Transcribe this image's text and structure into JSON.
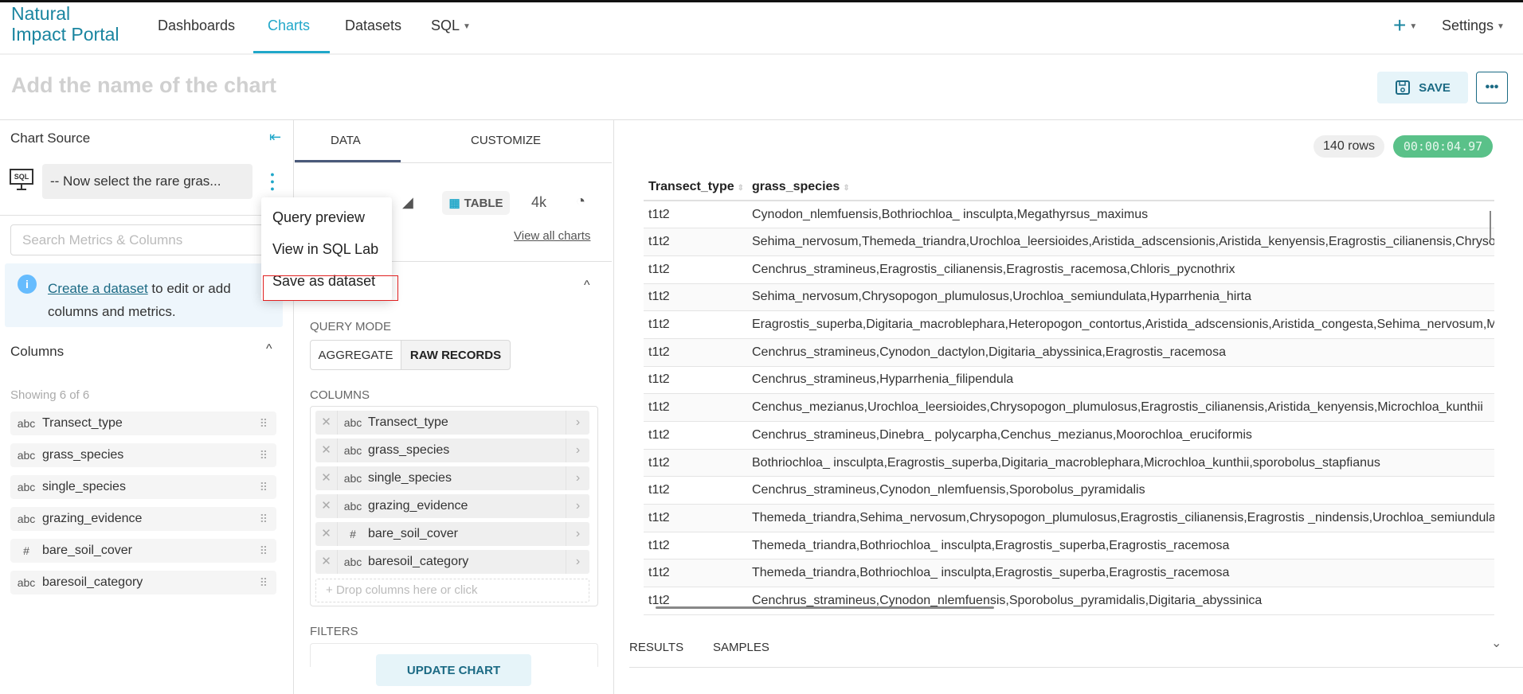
{
  "nav": {
    "logo_line1": "Natural",
    "logo_line2": "Impact Portal",
    "items": [
      {
        "label": "Dashboards"
      },
      {
        "label": "Charts"
      },
      {
        "label": "Datasets"
      },
      {
        "label": "SQL"
      }
    ],
    "plus": "+",
    "settings": "Settings"
  },
  "header": {
    "title_placeholder": "Add the name of the chart",
    "save": "SAVE",
    "more": "•••"
  },
  "source": {
    "heading": "Chart Source",
    "sql_icon": "SQL",
    "query_name": "-- Now select the rare gras...",
    "search_placeholder": "Search Metrics & Columns",
    "info_link": "Create a dataset",
    "info_rest": " to edit or add columns and metrics."
  },
  "menu": {
    "items": [
      "Query preview",
      "View in SQL Lab",
      "Save as dataset"
    ]
  },
  "columns_panel": {
    "heading": "Columns",
    "showing": "Showing 6 of 6",
    "items": [
      {
        "type": "abc",
        "name": "Transect_type"
      },
      {
        "type": "abc",
        "name": "grass_species"
      },
      {
        "type": "abc",
        "name": "single_species"
      },
      {
        "type": "abc",
        "name": "grazing_evidence"
      },
      {
        "type": "#",
        "name": "bare_soil_cover"
      },
      {
        "type": "abc",
        "name": "baresoil_category"
      }
    ]
  },
  "control": {
    "tabs": [
      "DATA",
      "CUSTOMIZE"
    ],
    "viz_table": "TABLE",
    "viz_4k": "4k",
    "view_all": "View all charts",
    "query_mode": "QUERY MODE",
    "modes": [
      "AGGREGATE",
      "RAW RECORDS"
    ],
    "columns_label": "COLUMNS",
    "drop_hint": "Drop columns here or click",
    "filters_label": "FILTERS",
    "update": "UPDATE CHART"
  },
  "results": {
    "rows_badge": "140 rows",
    "timer": "00:00:04.97",
    "timer_color": "#5ac189",
    "headers": [
      "Transect_type",
      "grass_species"
    ],
    "rows": [
      [
        "t1t2",
        "Cynodon_nlemfuensis,Bothriochloa_ insculpta,Megathyrsus_maximus"
      ],
      [
        "t1t2",
        "Sehima_nervosum,Themeda_triandra,Urochloa_leersioides,Aristida_adscensionis,Aristida_kenyensis,Eragrostis_cilianensis,Chrysopo"
      ],
      [
        "t1t2",
        "Cenchrus_stramineus,Eragrostis_cilianensis,Eragrostis_racemosa,Chloris_pycnothrix"
      ],
      [
        "t1t2",
        "Sehima_nervosum,Chrysopogon_plumulosus,Urochloa_semiundulata,Hyparrhenia_hirta"
      ],
      [
        "t1t2",
        "Eragrostis_superba,Digitaria_macroblephara,Heteropogon_contortus,Aristida_adscensionis,Aristida_congesta,Sehima_nervosum,Me"
      ],
      [
        "t1t2",
        "Cenchrus_stramineus,Cynodon_dactylon,Digitaria_abyssinica,Eragrostis_racemosa"
      ],
      [
        "t1t2",
        "Cenchrus_stramineus,Hyparrhenia_filipendula"
      ],
      [
        "t1t2",
        "Cenchus_mezianus,Urochloa_leersioides,Chrysopogon_plumulosus,Eragrostis_cilianensis,Aristida_kenyensis,Microchloa_kunthii"
      ],
      [
        "t1t2",
        "Cenchrus_stramineus,Dinebra_ polycarpha,Cenchus_mezianus,Moorochloa_eruciformis"
      ],
      [
        "t1t2",
        "Bothriochloa_ insculpta,Eragrostis_superba,Digitaria_macroblephara,Microchloa_kunthii,sporobolus_stapfianus"
      ],
      [
        "t1t2",
        "Cenchrus_stramineus,Cynodon_nlemfuensis,Sporobolus_pyramidalis"
      ],
      [
        "t1t2",
        "Themeda_triandra,Sehima_nervosum,Chrysopogon_plumulosus,Eragrostis_cilianensis,Eragrostis _nindensis,Urochloa_semiundulata"
      ],
      [
        "t1t2",
        "Themeda_triandra,Bothriochloa_ insculpta,Eragrostis_superba,Eragrostis_racemosa"
      ],
      [
        "t1t2",
        "Themeda_triandra,Bothriochloa_ insculpta,Eragrostis_superba,Eragrostis_racemosa"
      ],
      [
        "t1t2",
        "Cenchrus_stramineus,Cynodon_nlemfuensis,Sporobolus_pyramidalis,Digitaria_abyssinica"
      ]
    ],
    "bottom_tabs": [
      "RESULTS",
      "SAMPLES"
    ]
  }
}
